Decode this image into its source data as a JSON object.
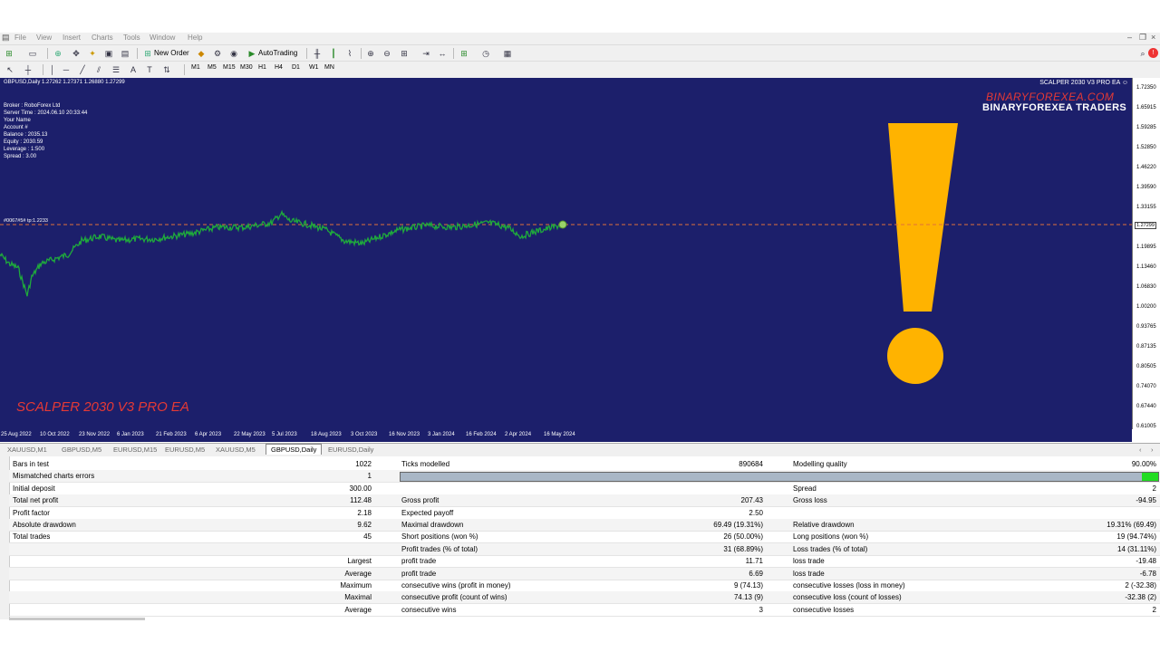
{
  "menu": [
    "File",
    "View",
    "Insert",
    "Charts",
    "Tools",
    "Window",
    "Help"
  ],
  "toolbar": {
    "new_order": "New Order",
    "autotrading": "AutoTrading",
    "timeframes": [
      "M1",
      "M5",
      "M15",
      "M30",
      "H1",
      "H4",
      "D1",
      "W1",
      "MN"
    ]
  },
  "chart": {
    "symbol_header": "GBPUSD,Daily  1.27262 1.27371 1.26880 1.27299",
    "ea_name_top": "SCALPER 2030 V3 PRO EA",
    "brand_url": "BINARYFOREXEA.COM",
    "brand_name": "BINARYFOREXEA TRADERS",
    "account_info": [
      "Broker  : RoboForex Ltd",
      "Server Time : 2024.06.10 20:33:44",
      "Your Name",
      "Account #",
      "Balance : 2035.13",
      "Equity   : 2030.59",
      "Leverage : 1:500",
      "Spread : 3.00"
    ],
    "line_label": "#0067#5# tp:1.2233",
    "ea_name_bottom": "SCALPER 2030 V3 PRO EA",
    "current_price": "1.27299",
    "price_labels": [
      "1.72350",
      "1.65915",
      "1.59285",
      "1.52850",
      "1.46220",
      "1.39590",
      "1.33155",
      "1.26525",
      "1.19895",
      "1.13460",
      "1.06830",
      "1.00200",
      "0.93765",
      "0.87135",
      "0.80505",
      "0.74070",
      "0.67440",
      "0.61005"
    ],
    "date_labels": [
      "25 Aug 2022",
      "10 Oct 2022",
      "23 Nov 2022",
      "6 Jan 2023",
      "21 Feb 2023",
      "6 Apr 2023",
      "22 May 2023",
      "5 Jul 2023",
      "18 Aug 2023",
      "3 Oct 2023",
      "16 Nov 2023",
      "3 Jan 2024",
      "16 Feb 2024",
      "2 Apr 2024",
      "16 May 2024"
    ],
    "bg_color": "#1c1f6b",
    "line_color": "#1faa3c",
    "accent_color": "#ffb300"
  },
  "tabs": [
    "XAUUSD,M1",
    "GBPUSD,M5",
    "EURUSD,M15",
    "EURUSD,M5",
    "XAUUSD,M5",
    "GBPUSD,Daily",
    "EURUSD,Daily"
  ],
  "active_tab": "GBPUSD,Daily",
  "report": {
    "modelling_quality_value": 90.0,
    "rows": [
      [
        "Bars in test",
        "1022",
        "Ticks modelled",
        "890684",
        "Modelling quality",
        "90.00%"
      ],
      [
        "Mismatched charts errors",
        "1",
        "",
        "",
        "",
        ""
      ],
      [
        "Initial deposit",
        "300.00",
        "",
        "",
        "Spread",
        "2"
      ],
      [
        "Total net profit",
        "112.48",
        "Gross profit",
        "207.43",
        "Gross loss",
        "-94.95"
      ],
      [
        "Profit factor",
        "2.18",
        "Expected payoff",
        "2.50",
        "",
        ""
      ],
      [
        "Absolute drawdown",
        "9.62",
        "Maximal drawdown",
        "69.49 (19.31%)",
        "Relative drawdown",
        "19.31% (69.49)"
      ],
      [
        "Total trades",
        "45",
        "Short positions (won %)",
        "26 (50.00%)",
        "Long positions (won %)",
        "19 (94.74%)"
      ],
      [
        "",
        "",
        "Profit trades (% of total)",
        "31 (68.89%)",
        "Loss trades (% of total)",
        "14 (31.11%)"
      ],
      [
        "",
        "Largest",
        "profit trade",
        "11.71",
        "loss trade",
        "-19.48"
      ],
      [
        "",
        "Average",
        "profit trade",
        "6.69",
        "loss trade",
        "-6.78"
      ],
      [
        "",
        "Maximum",
        "consecutive wins (profit in money)",
        "9 (74.13)",
        "consecutive losses (loss in money)",
        "2 (-32.38)"
      ],
      [
        "",
        "Maximal",
        "consecutive profit (count of wins)",
        "74.13 (9)",
        "consecutive loss (count of losses)",
        "-32.38 (2)"
      ],
      [
        "",
        "Average",
        "consecutive wins",
        "3",
        "consecutive losses",
        "2"
      ]
    ]
  }
}
